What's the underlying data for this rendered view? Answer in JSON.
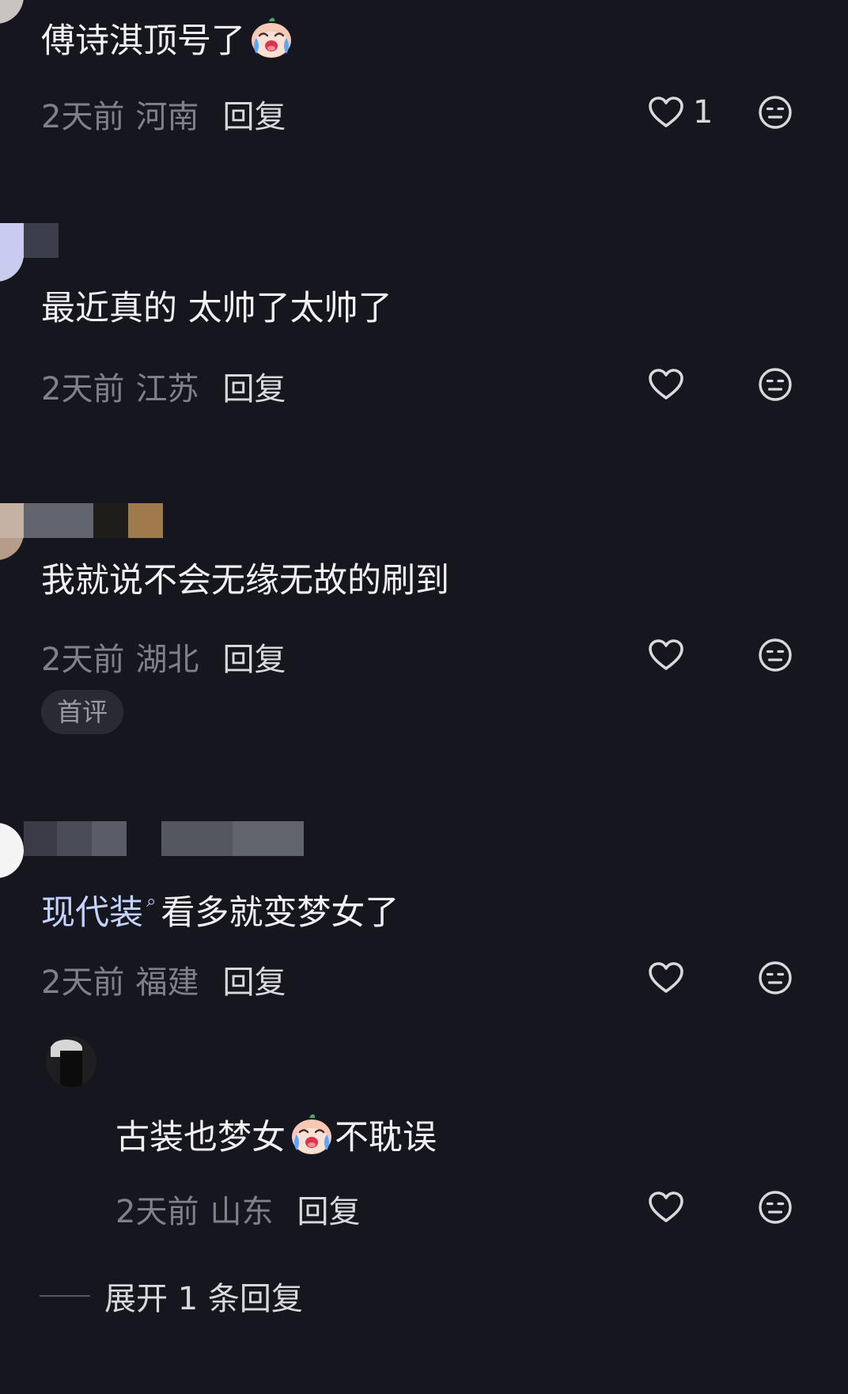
{
  "colors": {
    "background": "#16161e",
    "primary_text": "#f1f1f5",
    "secondary_text": "#80808c",
    "reply_text": "#d8d8de",
    "link_text": "#c5d3ff",
    "badge_bg": "#2a2a33"
  },
  "comments": [
    {
      "text": "傅诗淇顶号了",
      "emoji": "crying-baby-emoji",
      "time": "2天前",
      "location": "河南",
      "reply_label": "回复",
      "like_count": "1"
    },
    {
      "text": "最近真的 太帅了太帅了",
      "time": "2天前",
      "location": "江苏",
      "reply_label": "回复"
    },
    {
      "text": "我就说不会无缘无故的刷到",
      "time": "2天前",
      "location": "湖北",
      "reply_label": "回复",
      "badge": "首评"
    },
    {
      "link_text": "现代装",
      "text_after": "看多就变梦女了",
      "time": "2天前",
      "location": "福建",
      "reply_label": "回复"
    }
  ],
  "sub_reply": {
    "text_before": "古装也梦女",
    "emoji": "crying-baby-emoji",
    "text_after": "不耽误",
    "time": "2天前",
    "location": "山东",
    "reply_label": "回复"
  },
  "expand_replies": {
    "label": "展开 1 条回复"
  },
  "icons": {
    "like": "heart-outline-icon",
    "dislike": "meh-face-icon",
    "search_hint": "search-small-icon"
  }
}
